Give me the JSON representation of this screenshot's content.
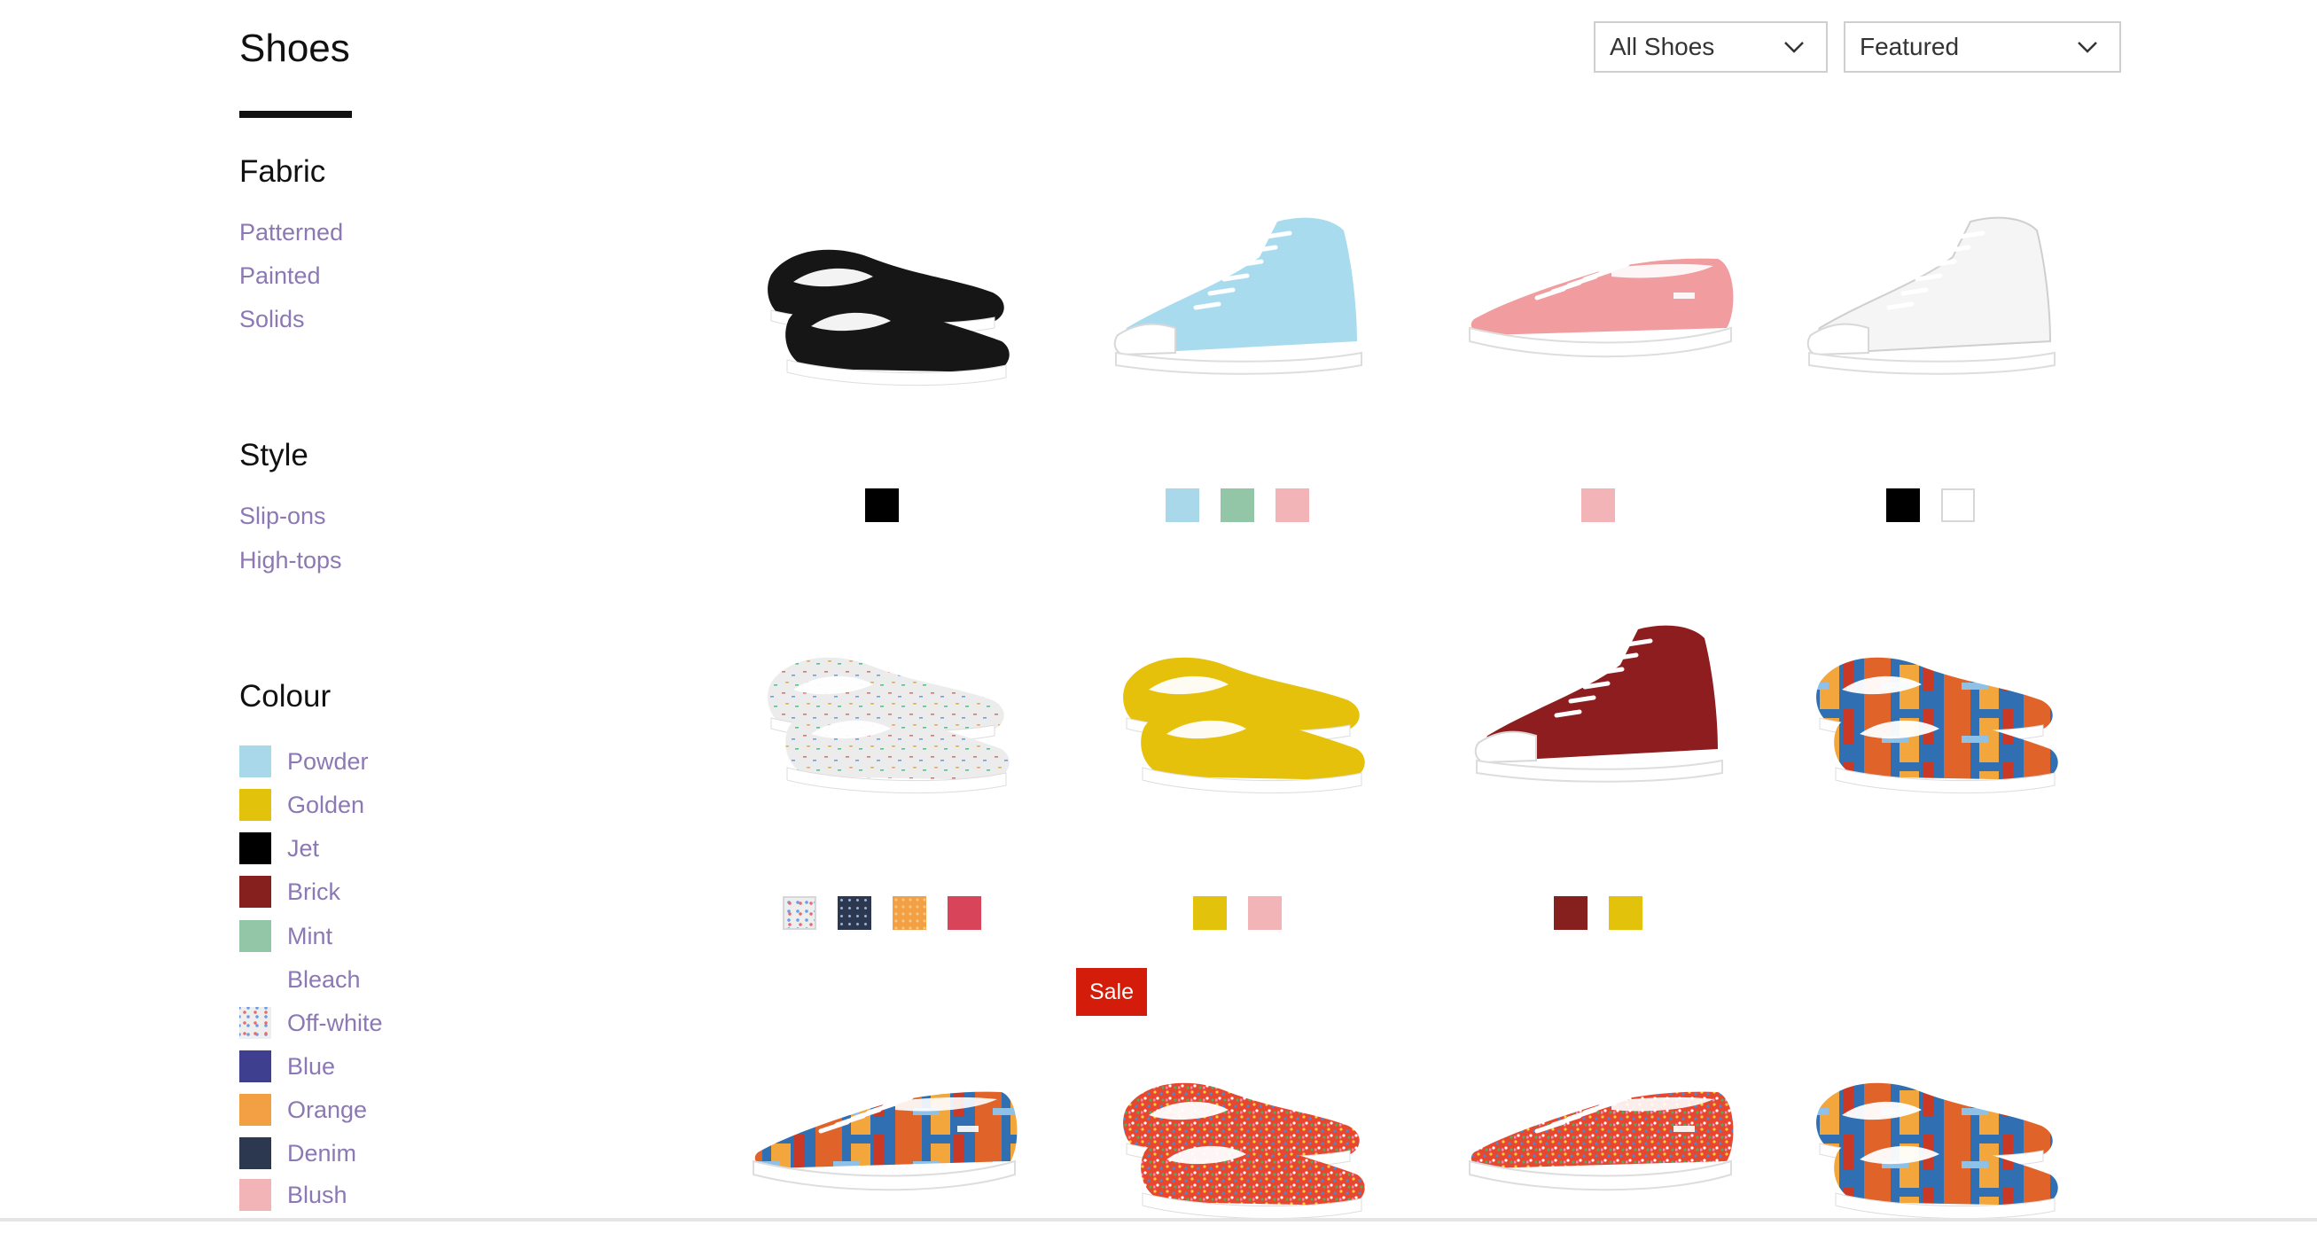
{
  "page": {
    "title": "Shoes"
  },
  "filters": {
    "fabric": {
      "heading": "Fabric",
      "items": [
        "Patterned",
        "Painted",
        "Solids"
      ]
    },
    "style": {
      "heading": "Style",
      "items": [
        "Slip-ons",
        "High-tops"
      ]
    },
    "colour": {
      "heading": "Colour",
      "items": [
        {
          "label": "Powder",
          "color": "#a8d8ea"
        },
        {
          "label": "Golden",
          "color": "#e2c20a"
        },
        {
          "label": "Jet",
          "color": "#000000"
        },
        {
          "label": "Brick",
          "color": "#85201e"
        },
        {
          "label": "Mint",
          "color": "#93c6a6"
        },
        {
          "label": "Bleach",
          "color": "#ffffff"
        },
        {
          "label": "Off-white",
          "color": "#eeeeee"
        },
        {
          "label": "Blue",
          "color": "#3f3f8f"
        },
        {
          "label": "Orange",
          "color": "#f3a045"
        },
        {
          "label": "Denim",
          "color": "#2b3850"
        },
        {
          "label": "Blush",
          "color": "#f2b4b6"
        }
      ]
    }
  },
  "toolbar": {
    "category_select": "All Shoes",
    "sort_select": "Featured"
  },
  "products": [
    {
      "style": "slip-on",
      "pattern": "solid",
      "color": "#161616",
      "swatches": [
        "#000000"
      ]
    },
    {
      "style": "high-top",
      "pattern": "solid",
      "color": "#a9dbef",
      "swatches": [
        "#a8d8ea",
        "#93c6a6",
        "#f2b4b6"
      ]
    },
    {
      "style": "low-top",
      "pattern": "solid",
      "color": "#f19c9e",
      "swatches": [
        "#f2b4b6"
      ]
    },
    {
      "style": "high-top",
      "pattern": "solid",
      "color": "#f5f5f5",
      "swatches": [
        "#000000",
        "#ffffff"
      ]
    },
    {
      "style": "slip-on",
      "pattern": "confetti",
      "color": "#eeeeee",
      "swatches": [
        "#eeeeee",
        "#2b3850",
        "#f3a045",
        "#d84459"
      ]
    },
    {
      "style": "slip-on",
      "pattern": "solid",
      "color": "#e6c10c",
      "swatches": [
        "#e2c20a",
        "#f2b4b6"
      ]
    },
    {
      "style": "high-top",
      "pattern": "solid",
      "color": "#8d1d1f",
      "swatches": [
        "#85201e",
        "#e2c20a"
      ]
    },
    {
      "style": "slip-on",
      "pattern": "painted",
      "color": "#e0632a",
      "swatches": []
    },
    {
      "style": "low-top",
      "pattern": "painted",
      "color": "#2f6fb2",
      "swatches": []
    },
    {
      "style": "slip-on",
      "pattern": "sprinkles",
      "color": "#e84a2a",
      "swatches": []
    },
    {
      "style": "low-top",
      "pattern": "sprinkles",
      "color": "#e64a2e",
      "swatches": []
    },
    {
      "style": "slip-on",
      "pattern": "painted",
      "color": "#3f7ebd",
      "swatches": []
    }
  ],
  "badges": {
    "sale": "Sale"
  }
}
